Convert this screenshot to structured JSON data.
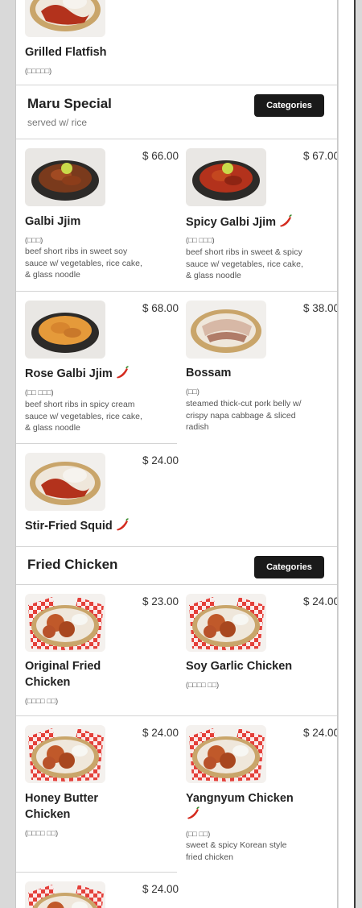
{
  "colors": {
    "background": "#d9d9d9",
    "card": "#ffffff",
    "button": "#1a1a1a",
    "chili": "#d42a1e"
  },
  "top_item": {
    "name": "Grilled Flatfish",
    "korean": "(□□□□□)"
  },
  "sections": {
    "maru_special": {
      "title": "Maru Special",
      "subtitle": "served w/ rice",
      "categories_label": "Categories",
      "items": [
        {
          "name": "Galbi Jjim",
          "price": "$ 66.00",
          "korean": "(□□□)",
          "description": "beef short ribs in sweet soy sauce w/ vegetables, rice cake, & glass noodle",
          "spicy": false
        },
        {
          "name": "Spicy Galbi Jjim",
          "price": "$ 67.00",
          "korean": "(□□ □□□)",
          "description": "beef short ribs in sweet & spicy sauce w/ vegetables, rice cake, & glass noodle",
          "spicy": true
        },
        {
          "name": "Rose Galbi Jjim",
          "price": "$ 68.00",
          "korean": "(□□ □□□)",
          "description": "beef short ribs in spicy cream sauce w/ vegetables, rice cake, & glass noodle",
          "spicy": true
        },
        {
          "name": "Bossam",
          "price": "$ 38.00",
          "korean": "(□□)",
          "description": "steamed thick-cut pork belly w/ crispy napa cabbage & sliced radish",
          "spicy": false
        },
        {
          "name": "Stir-Fried Squid",
          "price": "$ 24.00",
          "korean": "",
          "description": "",
          "spicy": true
        }
      ]
    },
    "fried_chicken": {
      "title": "Fried Chicken",
      "categories_label": "Categories",
      "items": [
        {
          "name": "Original Fried Chicken",
          "price": "$ 23.00",
          "korean": "(□□□□ □□)",
          "description": "",
          "spicy": false
        },
        {
          "name": "Soy Garlic Chicken",
          "price": "$ 24.00",
          "korean": "(□□□□ □□)",
          "description": "",
          "spicy": false
        },
        {
          "name": "Honey Butter Chicken",
          "price": "$ 24.00",
          "korean": "(□□□□ □□)",
          "description": "",
          "spicy": false
        },
        {
          "name": "Yangnyum Chicken",
          "price": "$ 24.00",
          "korean": "(□□ □□)",
          "description": "sweet & spicy Korean style fried chicken",
          "spicy": true
        },
        {
          "name": "",
          "price": "$ 24.00",
          "korean": "",
          "description": "",
          "spicy": false
        }
      ]
    }
  }
}
